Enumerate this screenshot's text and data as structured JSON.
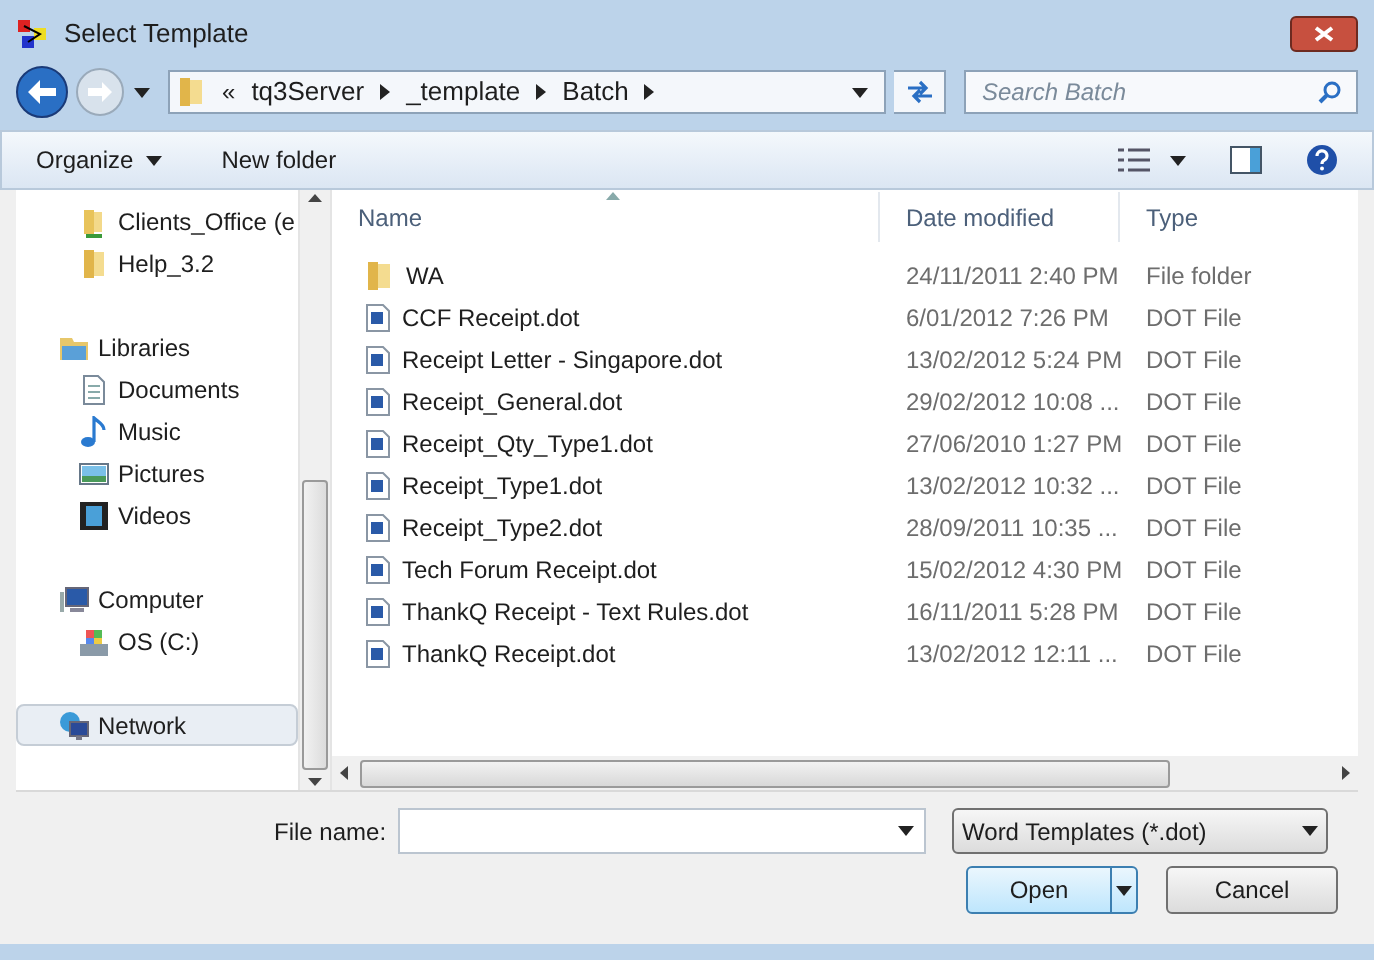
{
  "window": {
    "title": "Select Template"
  },
  "breadcrumb": {
    "overflow": "«",
    "parts": [
      "tq3Server",
      "_template",
      "Batch"
    ]
  },
  "search": {
    "placeholder": "Search Batch"
  },
  "toolbar": {
    "organize": "Organize",
    "new_folder": "New folder"
  },
  "nav_pane": {
    "items": [
      {
        "label": "Clients_Office (e",
        "kind": "shared-folder",
        "selected": false
      },
      {
        "label": "Help_3.2",
        "kind": "folder",
        "selected": false
      },
      {
        "label": "Libraries",
        "kind": "library",
        "selected": false,
        "children": [
          {
            "label": "Documents",
            "kind": "documents",
            "selected": false
          },
          {
            "label": "Music",
            "kind": "music",
            "selected": false
          },
          {
            "label": "Pictures",
            "kind": "pictures",
            "selected": false
          },
          {
            "label": "Videos",
            "kind": "videos",
            "selected": false
          }
        ]
      },
      {
        "label": "Computer",
        "kind": "computer",
        "selected": false,
        "children": [
          {
            "label": "OS (C:)",
            "kind": "drive",
            "selected": false
          }
        ]
      },
      {
        "label": "Network",
        "kind": "network",
        "selected": true
      }
    ]
  },
  "table": {
    "columns": [
      "Name",
      "Date modified",
      "Type"
    ],
    "rows": [
      {
        "kind": "folder",
        "name": "WA",
        "date": "24/11/2011 2:40 PM",
        "type": "File folder"
      },
      {
        "kind": "doc",
        "name": "CCF Receipt.dot",
        "date": "6/01/2012 7:26 PM",
        "type": "DOT File"
      },
      {
        "kind": "doc",
        "name": "Receipt Letter - Singapore.dot",
        "date": "13/02/2012 5:24 PM",
        "type": "DOT File"
      },
      {
        "kind": "doc",
        "name": "Receipt_General.dot",
        "date": "29/02/2012 10:08 ...",
        "type": "DOT File"
      },
      {
        "kind": "doc",
        "name": "Receipt_Qty_Type1.dot",
        "date": "27/06/2010 1:27 PM",
        "type": "DOT File"
      },
      {
        "kind": "doc",
        "name": "Receipt_Type1.dot",
        "date": "13/02/2012 10:32 ...",
        "type": "DOT File"
      },
      {
        "kind": "doc",
        "name": "Receipt_Type2.dot",
        "date": "28/09/2011 10:35 ...",
        "type": "DOT File"
      },
      {
        "kind": "doc",
        "name": "Tech Forum Receipt.dot",
        "date": "15/02/2012 4:30 PM",
        "type": "DOT File"
      },
      {
        "kind": "doc",
        "name": "ThankQ Receipt - Text Rules.dot",
        "date": "16/11/2011 5:28 PM",
        "type": "DOT File"
      },
      {
        "kind": "doc",
        "name": "ThankQ Receipt.dot",
        "date": "13/02/2012 12:11 ...",
        "type": "DOT File"
      }
    ]
  },
  "file_name": {
    "label": "File name:"
  },
  "file_type": {
    "value": "Word Templates (*.dot)"
  },
  "buttons": {
    "open": "Open",
    "cancel": "Cancel"
  }
}
